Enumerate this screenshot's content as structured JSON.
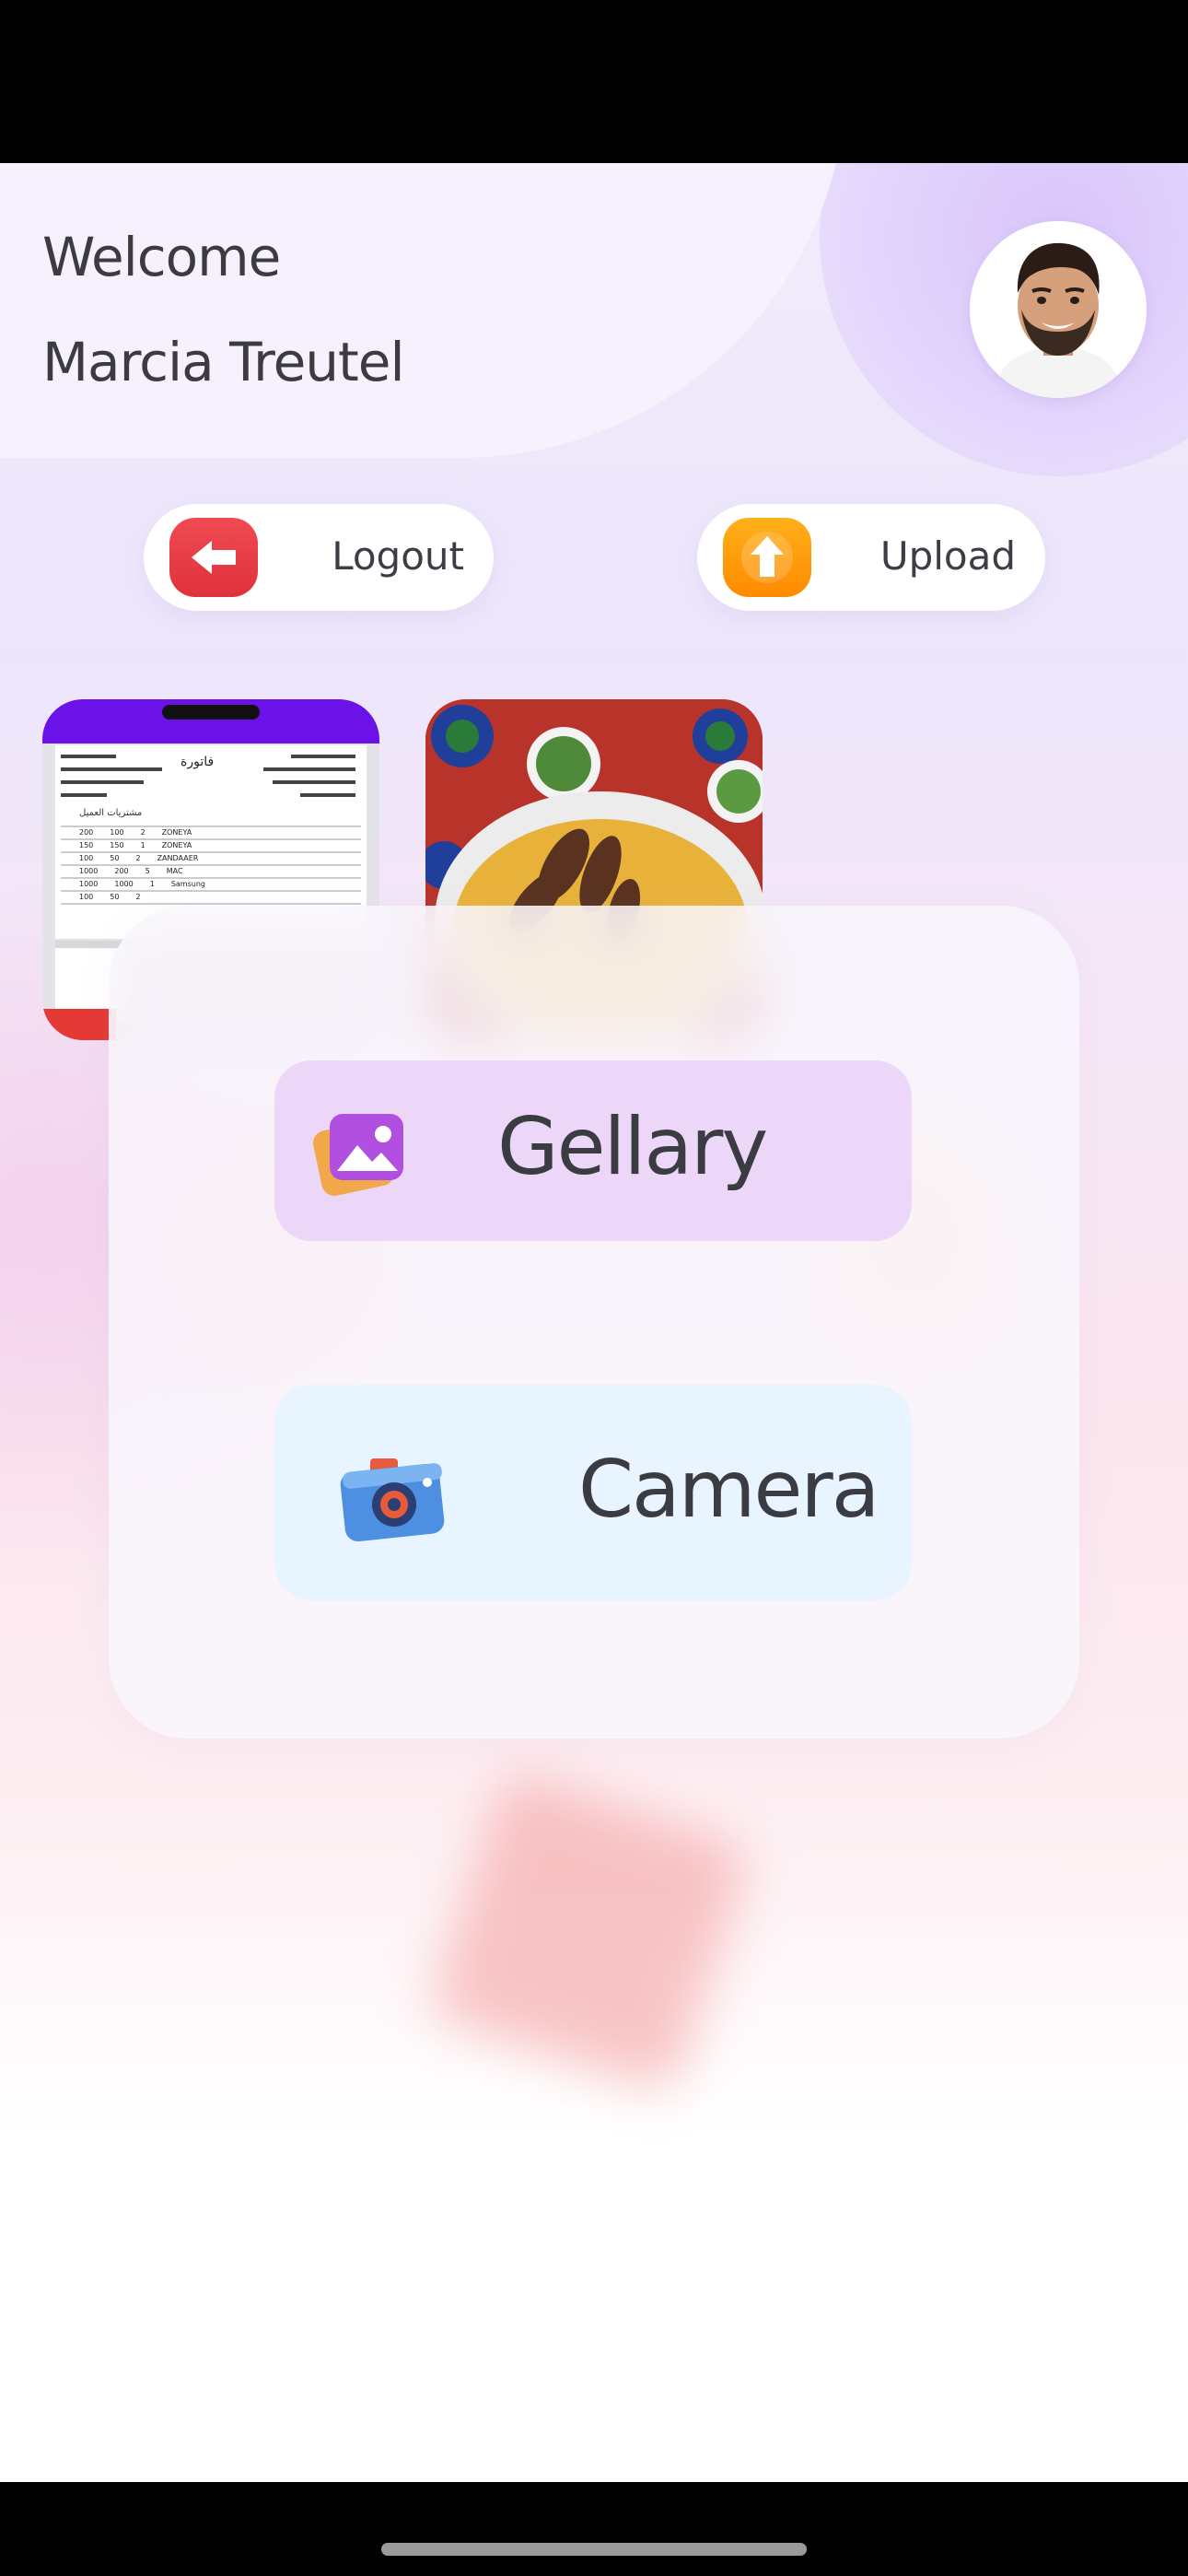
{
  "header": {
    "welcome": "Welcome",
    "user_name": "Marcia Treutel",
    "avatar_icon": "user-avatar-photo"
  },
  "actions": {
    "logout_label": "Logout",
    "logout_icon": "arrow-left-icon",
    "upload_label": "Upload",
    "upload_icon": "arrow-up-icon"
  },
  "thumbnails": {
    "receipt_title": "فاتورة",
    "receipt_header": "ﻣﺸﺘﺮﻳﺎت اﻟﻌﻤﻴﻞ",
    "receipt_rows": [
      [
        "200",
        "100",
        "2",
        "ZONEYA"
      ],
      [
        "150",
        "150",
        "1",
        "ZONEYA"
      ],
      [
        "100",
        "50",
        "2",
        "ZANDAAER"
      ],
      [
        "1000",
        "200",
        "5",
        "MAC"
      ],
      [
        "1000",
        "1000",
        "1",
        "Samsung"
      ],
      [
        "100",
        "50",
        "2",
        ""
      ]
    ],
    "food_icon": "food-photo"
  },
  "picker": {
    "gallery_label": "Gellary",
    "gallery_icon": "gallery-image-icon",
    "camera_label": "Camera",
    "camera_icon": "camera-icon"
  },
  "colors": {
    "logout_accent": "#e53a42",
    "upload_accent": "#ff9a0a",
    "gallery_bg": "#ecd7f8",
    "camera_bg": "#e8f4ff"
  }
}
